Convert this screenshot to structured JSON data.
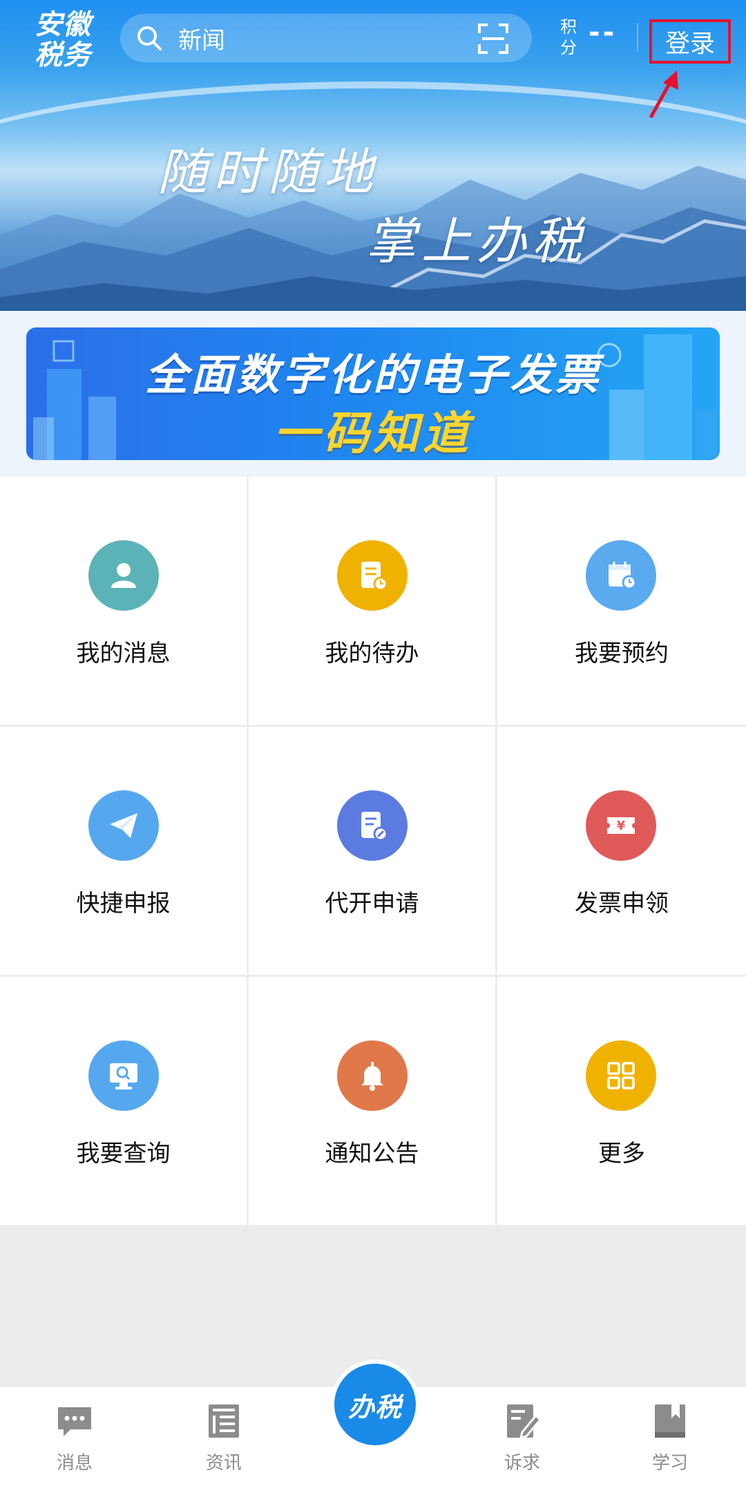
{
  "header": {
    "logo_line1": "安徽",
    "logo_line2": "税务",
    "search": {
      "placeholder": "新闻",
      "search_icon": "search-icon",
      "scan_icon": "scan-icon"
    },
    "points": {
      "label_line1": "积",
      "label_line2": "分",
      "value": "--"
    },
    "login_label": "登录"
  },
  "hero": {
    "slogan_line1": "随时随地",
    "slogan_line2": "掌上办税"
  },
  "banner": {
    "line1": "全面数字化的电子发票",
    "line2": "一码知道"
  },
  "grid": {
    "items": [
      {
        "label": "我的消息",
        "icon": "user-icon",
        "color": "#5bb3b8"
      },
      {
        "label": "我的待办",
        "icon": "todo-document-icon",
        "color": "#f0b200"
      },
      {
        "label": "我要预约",
        "icon": "calendar-clock-icon",
        "color": "#5aaaf0"
      },
      {
        "label": "快捷申报",
        "icon": "paper-plane-icon",
        "color": "#56a8ee"
      },
      {
        "label": "代开申请",
        "icon": "document-edit-icon",
        "color": "#5c7be0"
      },
      {
        "label": "发票申领",
        "icon": "invoice-yuan-icon",
        "color": "#e05a5a"
      },
      {
        "label": "我要查询",
        "icon": "monitor-search-icon",
        "color": "#56a8ee"
      },
      {
        "label": "通知公告",
        "icon": "bell-icon",
        "color": "#e0784a"
      },
      {
        "label": "更多",
        "icon": "grid-more-icon",
        "color": "#f0b200"
      }
    ]
  },
  "tabbar": {
    "tabs": [
      {
        "label": "消息",
        "icon": "chat-bubble-icon"
      },
      {
        "label": "资讯",
        "icon": "newspaper-icon"
      },
      {
        "label": "诉求",
        "icon": "edit-note-icon"
      },
      {
        "label": "学习",
        "icon": "bookmark-book-icon"
      }
    ],
    "center_label": "办税"
  }
}
